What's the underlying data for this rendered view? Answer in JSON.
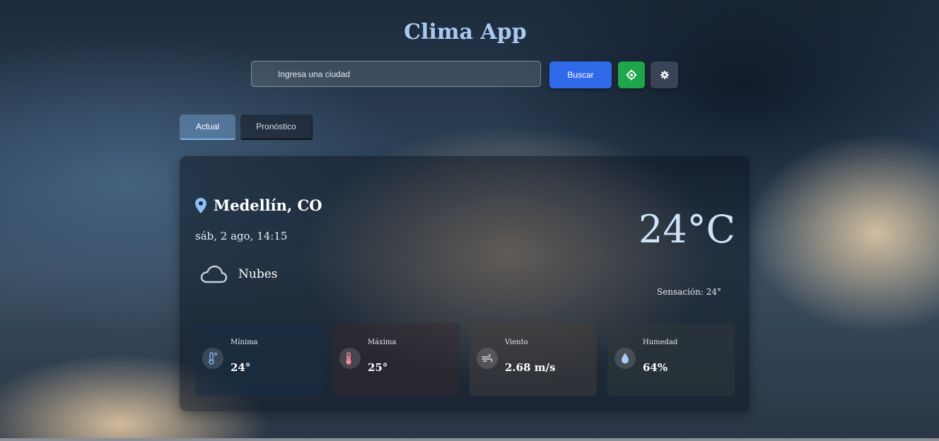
{
  "app": {
    "title": "Clima App"
  },
  "search": {
    "placeholder": "Ingresa una ciudad",
    "button_label": "Buscar"
  },
  "icons": {
    "location_button": "crosshair-icon",
    "settings_button": "gear-icon"
  },
  "tabs": [
    {
      "label": "Actual",
      "active": true
    },
    {
      "label": "Pronóstico",
      "active": false
    }
  ],
  "weather": {
    "city": "Medellín, CO",
    "datetime": "sáb, 2 ago, 14:15",
    "condition": "Nubes",
    "condition_icon": "cloud-icon",
    "temperature": "24°C",
    "feels_like": "Sensación: 24°"
  },
  "stats": [
    {
      "label": "Mínima",
      "value": "24°",
      "icon": "thermometer-icon"
    },
    {
      "label": "Máxima",
      "value": "25°",
      "icon": "thermometer-icon"
    },
    {
      "label": "Viento",
      "value": "2.68 m/s",
      "icon": "wind-icon"
    },
    {
      "label": "Humedad",
      "value": "64%",
      "icon": "droplet-icon"
    }
  ],
  "colors": {
    "title": "#a9c9f2",
    "search_button": "#2f6ae8",
    "location_button": "#1fa54a",
    "settings_button": "#3a4456",
    "temperature": "#cfe2fb",
    "pin": "#8ec0f5",
    "min_temp_icon": "#7fb1ea",
    "max_temp_icon": "#f08a9a"
  }
}
